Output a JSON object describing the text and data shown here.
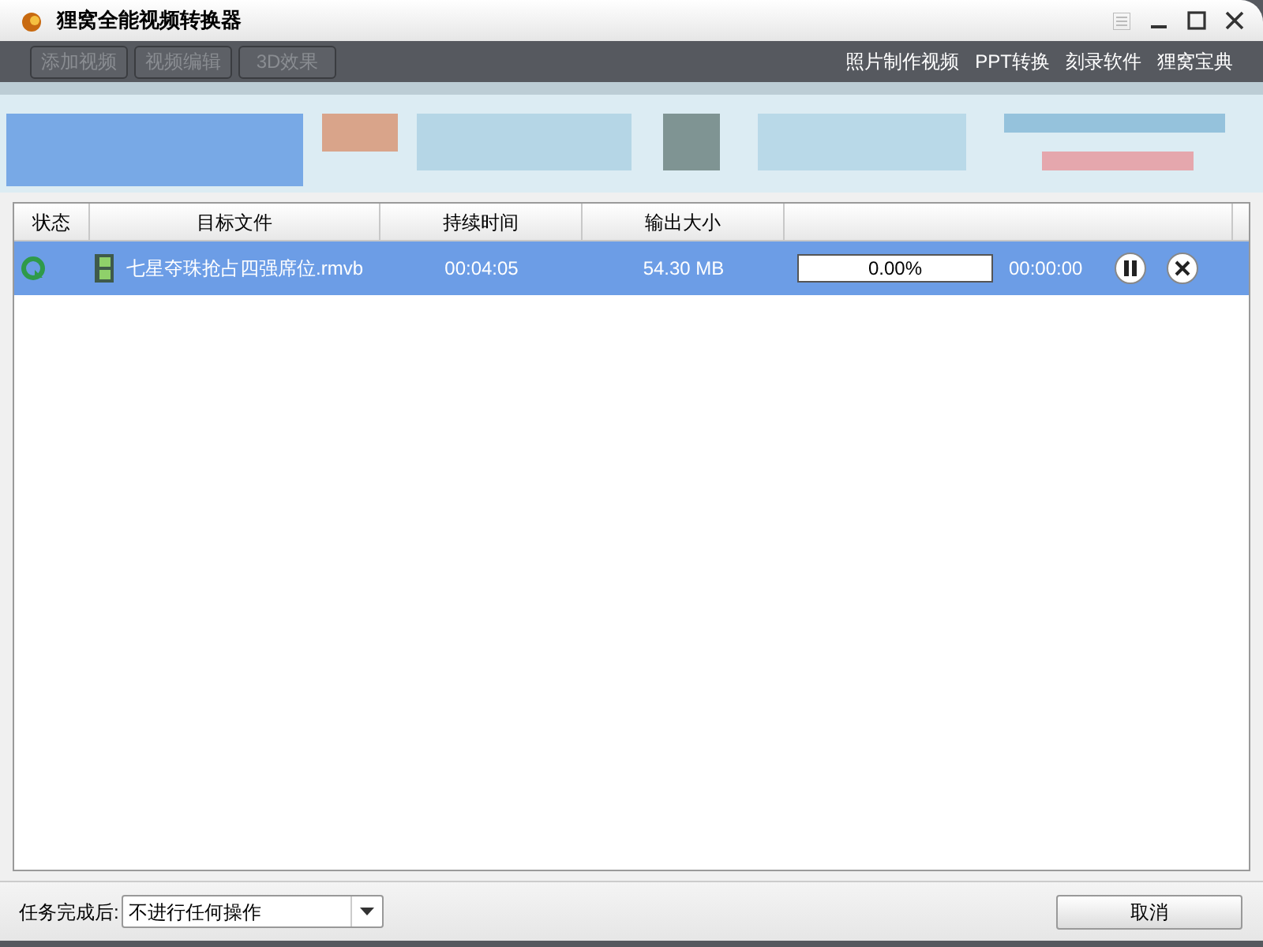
{
  "window": {
    "title": "狸窝全能视频转换器"
  },
  "toolbar": {
    "buttons": [
      {
        "label": "添加视频",
        "disabled": true
      },
      {
        "label": "视频编辑",
        "disabled": true
      },
      {
        "label": "3D效果",
        "disabled": true
      }
    ],
    "links": [
      "照片制作视频",
      "PPT转换",
      "刻录软件",
      "狸窝宝典"
    ]
  },
  "table": {
    "columns": [
      "状态",
      "目标文件",
      "持续时间",
      "输出大小"
    ],
    "rows": [
      {
        "selected": true,
        "file": "七星夺珠抢占四强席位.rmvb",
        "duration": "00:04:05",
        "size": "54.30 MB",
        "progress": {
          "level": 0,
          "reading": "0.00%"
        },
        "remaining": "00:00:00"
      }
    ]
  },
  "footer": {
    "label": "任务完成后:",
    "select_value": "不进行任何操作",
    "cancel": "取消"
  }
}
